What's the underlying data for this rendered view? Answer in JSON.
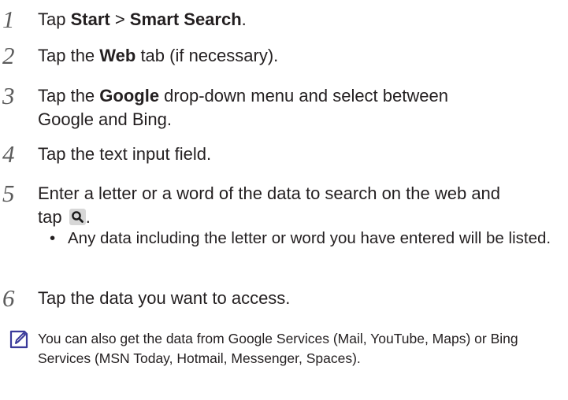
{
  "steps": [
    {
      "number": "1",
      "pre": "Tap ",
      "b1": "Start",
      "mid": " > ",
      "b2": "Smart Search",
      "post": "."
    },
    {
      "number": "2",
      "pre": "Tap the ",
      "b1": "Web",
      "post": " tab (if necessary)."
    },
    {
      "number": "3",
      "pre": "Tap the ",
      "b1": "Google",
      "post": " drop-down menu and select between Google and Bing."
    },
    {
      "number": "4",
      "text": "Tap the text input field."
    },
    {
      "number": "5",
      "pre": "Enter a letter or a word of the data to search on the web and tap ",
      "icon": "search-icon",
      "post": "."
    },
    {
      "number": "6",
      "text": "Tap the data you want to access."
    }
  ],
  "bullet": {
    "symbol": "•",
    "text": "Any data including the letter or word you have entered will be listed."
  },
  "note": {
    "icon": "note-icon",
    "text": "You can also get the data from Google Services (Mail, YouTube, Maps) or Bing Services (MSN Today, Hotmail, Messenger, Spaces)."
  }
}
